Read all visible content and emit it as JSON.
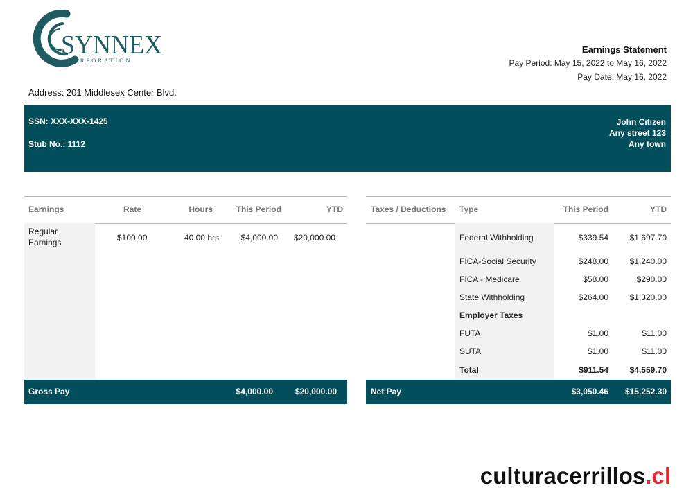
{
  "company": {
    "logo_name": "SYNNEX",
    "logo_sub": "CORPORATION",
    "logo_color": "#1f5b61"
  },
  "statement": {
    "title": "Earnings Statement",
    "pay_period": "Pay Period: May 15, 2022 to May 16, 2022",
    "pay_date": "Pay Date: May 16, 2022"
  },
  "address": "Address:  201 Middlesex Center Blvd.",
  "band": {
    "ssn": "SSN: XXX-XXX-1425",
    "stub": "Stub No.: 1112",
    "employee_name": "John Citizen",
    "employee_street": "Any street 123",
    "employee_town": "Any town",
    "color": "#034e5b"
  },
  "earnings": {
    "headers": [
      "Earnings",
      "Rate",
      "Hours",
      "This Period",
      "YTD"
    ],
    "rows": [
      {
        "label": "Regular Earnings",
        "rate": "$100.00",
        "hours": "40.00 hrs",
        "this_period": "$4,000.00",
        "ytd": "$20,000.00"
      }
    ],
    "footer": {
      "label": "Gross Pay",
      "this_period": "$4,000.00",
      "ytd": "$20,000.00"
    }
  },
  "taxes": {
    "headers": [
      "Taxes / Deductions",
      "Type",
      "This Period",
      "YTD"
    ],
    "rows": [
      {
        "type": "Federal Withholding",
        "this_period": "$339.54",
        "ytd": "$1,697.70"
      },
      {
        "type": "FICA-Social Security",
        "this_period": "$248.00",
        "ytd": "$1,240.00"
      },
      {
        "type": "FICA - Medicare",
        "this_period": "$58.00",
        "ytd": "$290.00"
      },
      {
        "type": "State Withholding",
        "this_period": "$264.00",
        "ytd": "$1,320.00"
      },
      {
        "type": "Employer Taxes",
        "this_period": "",
        "ytd": ""
      },
      {
        "type": "FUTA",
        "this_period": "$1.00",
        "ytd": "$11.00"
      },
      {
        "type": "SUTA",
        "this_period": "$1.00",
        "ytd": "$11.00"
      },
      {
        "type": "Total",
        "this_period": "$911.54",
        "ytd": "$4,559.70"
      }
    ],
    "footer": {
      "label": "Net Pay",
      "this_period": "$3,050.46",
      "ytd": "$15,252.30"
    }
  },
  "watermark": {
    "main": "culturacerrillos",
    "suffix": ".cl"
  }
}
